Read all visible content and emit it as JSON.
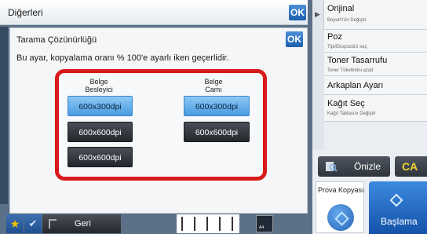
{
  "header": {
    "title": "Diğerleri",
    "ok_label": "OK"
  },
  "right_panel": {
    "items": [
      {
        "label": "Orijinal",
        "sub": "Boyut/Yön Değiştir"
      },
      {
        "label": "Poz",
        "sub": "Tipi/Ekspozürü seç"
      },
      {
        "label": "Toner Tasarrufu",
        "sub": "Toner Tüketimini azalt"
      },
      {
        "label": "Arkaplan Ayarı",
        "sub": ""
      },
      {
        "label": "Kağıt Seç",
        "sub": "Kağıt Tablasını Değiştir"
      }
    ],
    "preview_label": "Önizle",
    "ca_label": "CA",
    "proof_label": "Prova Kopyası",
    "start_label": "Başlama"
  },
  "dialog": {
    "ok_label": "OK",
    "title": "Tarama Çözünürlüğü",
    "description": "Bu ayar, kopyalama oranı % 100'e ayarlı iken geçerlidir.",
    "columns": [
      {
        "head_line1": "Belge",
        "head_line2": "Besleyici",
        "options": [
          "600x300dpi",
          "600x600dpi",
          "600x600dpi"
        ],
        "selected_index": 0
      },
      {
        "head_line1": "Belge",
        "head_line2": "Camı",
        "options": [
          "600x300dpi",
          "600x600dpi"
        ],
        "selected_index": 0
      }
    ]
  },
  "bottom_bar": {
    "back_label": "Geri",
    "paper_label": "A4"
  },
  "colors": {
    "accent_blue": "#2a74c6",
    "highlight_red": "#d81a1a",
    "selected_option": "#6db3ee"
  }
}
